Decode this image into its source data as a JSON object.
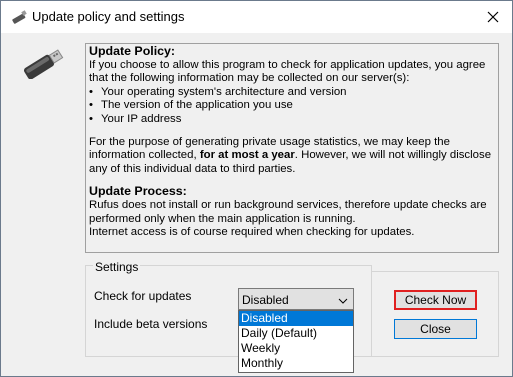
{
  "window": {
    "title": "Update policy and settings"
  },
  "policy": {
    "heading1": "Update Policy:",
    "intro": "If you choose to allow this program to check for application updates, you agree that the following information may be collected on our server(s):",
    "bullets": [
      "Your operating system's architecture and version",
      "The version of the application you use",
      "Your IP address"
    ],
    "para_pre": "For the purpose of generating private usage statistics, we may keep the information collected, ",
    "para_bold": "for at most a year",
    "para_post": ". However, we will not willingly disclose any of this individual data to third parties.",
    "heading2": "Update Process:",
    "process": "Rufus does not install or run background services, therefore update checks are performed only when the main application is running.",
    "internet": "Internet access is of course required when checking for updates."
  },
  "settings": {
    "group_label": "Settings",
    "check_label": "Check for updates",
    "beta_label": "Include beta versions",
    "selected_value": "Disabled",
    "options": [
      "Disabled",
      "Daily (Default)",
      "Weekly",
      "Monthly"
    ]
  },
  "buttons": {
    "check_now": "Check Now",
    "close": "Close"
  },
  "colors": {
    "highlight": "#0078d7",
    "check_outline": "#e02020"
  }
}
